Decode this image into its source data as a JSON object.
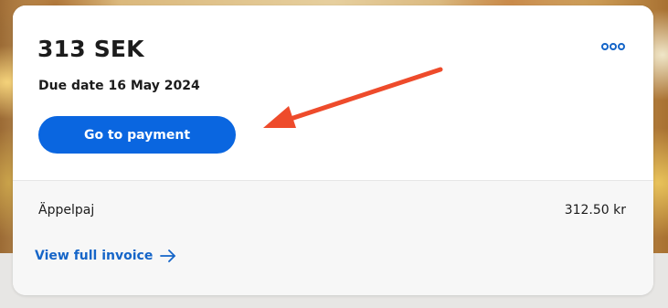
{
  "invoice": {
    "amount": "313 SEK",
    "due_date": "Due date 16 May 2024",
    "pay_button_label": "Go to payment",
    "more_icon": "more-horizontal-icon"
  },
  "line_items": [
    {
      "name": "Äppelpaj",
      "price": "312.50 kr"
    }
  ],
  "footer": {
    "view_invoice_label": "View full invoice",
    "view_invoice_icon": "arrow-right-icon"
  },
  "colors": {
    "primary": "#0a66e0",
    "link": "#1565c8",
    "annotation_arrow": "#ee4b2b",
    "text": "#1c1c1c"
  }
}
